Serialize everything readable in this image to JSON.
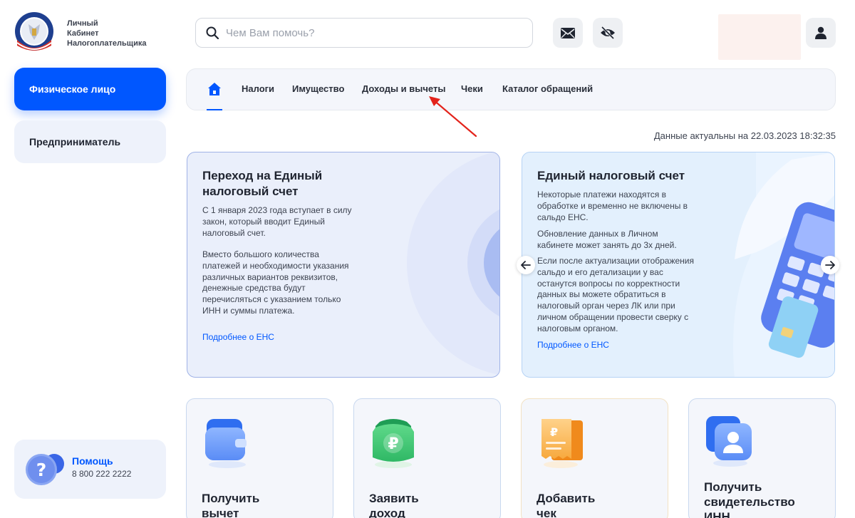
{
  "header": {
    "logo_text": [
      "Личный",
      "Кабинет",
      "Налогоплательщика"
    ],
    "search_placeholder": "Чем Вам помочь?"
  },
  "sidebar": {
    "items": [
      {
        "label": "Физическое лицо",
        "active": true
      },
      {
        "label": "Предприниматель",
        "active": false
      }
    ],
    "help": {
      "title": "Помощь",
      "phone": "8 800 222 2222"
    }
  },
  "nav": {
    "items": [
      "Налоги",
      "Имущество",
      "Доходы и вычеты",
      "Чеки",
      "Каталог обращений"
    ]
  },
  "actuality": "Данные актуальны на 22.03.2023 18:32:35",
  "cards": {
    "left": {
      "title": [
        "Переход на Единый",
        "налоговый счет"
      ],
      "paragraph1": [
        "С 1 января 2023 года вступает в силу",
        "закон, который вводит Единый",
        "налоговый счет."
      ],
      "paragraph2": [
        "Вместо большого количества",
        "платежей и необходимости указания",
        "различных вариантов реквизитов,",
        "денежные средства будут",
        "перечисляться с указанием только",
        "ИНН и суммы платежа."
      ],
      "link": "Подробнее о ЕНС"
    },
    "right": {
      "title": "Единый налоговый счет",
      "paragraph1": [
        "Некоторые платежи находятся в",
        "обработке и временно не включены в",
        "сальдо ЕНС."
      ],
      "paragraph2": [
        "Обновление данных в Личном",
        "кабинете может занять до 3х дней."
      ],
      "paragraph3": [
        "Если после актуализации отображения",
        "сальдо и его детализации у вас",
        "останутся вопросы по корректности",
        "данных вы можете обратиться в",
        "налоговый орган через ЛК или при",
        "личном обращении провести сверку с",
        "налоговым органом."
      ],
      "link": "Подробнее о ЕНС"
    }
  },
  "tiles": [
    {
      "label": [
        "Получить",
        "вычет"
      ],
      "icon": "wallet-icon"
    },
    {
      "label": [
        "Заявить",
        "доход"
      ],
      "icon": "ruble-icon"
    },
    {
      "label": [
        "Добавить",
        "чек"
      ],
      "icon": "receipt-icon"
    },
    {
      "label": [
        "Получить",
        "свидетельство",
        "ИНН"
      ],
      "icon": "id-card-icon"
    }
  ],
  "colors": {
    "accent": "#0057ff",
    "annotation_arrow": "#e3231b"
  }
}
